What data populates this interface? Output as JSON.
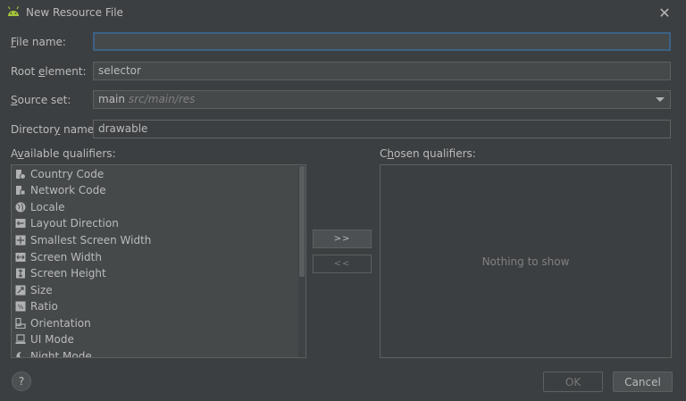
{
  "window": {
    "title": "New Resource File",
    "icon": "android-icon",
    "close_icon": "close-icon"
  },
  "form": {
    "file_name": {
      "label_key": "F",
      "label_rest": "ile name:",
      "value": ""
    },
    "root_element": {
      "label_pre": "Root ",
      "label_key": "e",
      "label_rest": "lement:",
      "value": "selector"
    },
    "source_set": {
      "label_key": "S",
      "label_rest": "ource set:",
      "value": "main",
      "hint": "src/main/res"
    },
    "directory_name": {
      "label_pre": "Director",
      "label_key": "y",
      "label_rest": " name:",
      "value": "drawable"
    }
  },
  "available": {
    "label_pre": "A",
    "label_key": "v",
    "label_rest": "ailable qualifiers:",
    "items": [
      {
        "label": "Country Code",
        "icon": "country-code-icon",
        "selected": true
      },
      {
        "label": "Network Code",
        "icon": "network-code-icon",
        "selected": false
      },
      {
        "label": "Locale",
        "icon": "globe-icon",
        "selected": false
      },
      {
        "label": "Layout Direction",
        "icon": "layout-direction-icon",
        "selected": false
      },
      {
        "label": "Smallest Screen Width",
        "icon": "smallest-width-icon",
        "selected": false
      },
      {
        "label": "Screen Width",
        "icon": "screen-width-icon",
        "selected": false
      },
      {
        "label": "Screen Height",
        "icon": "screen-height-icon",
        "selected": false
      },
      {
        "label": "Size",
        "icon": "size-icon",
        "selected": false
      },
      {
        "label": "Ratio",
        "icon": "ratio-icon",
        "selected": false
      },
      {
        "label": "Orientation",
        "icon": "orientation-icon",
        "selected": false
      },
      {
        "label": "UI Mode",
        "icon": "ui-mode-icon",
        "selected": false
      },
      {
        "label": "Night Mode",
        "icon": "night-mode-icon",
        "selected": false
      }
    ]
  },
  "chosen": {
    "label_pre": "C",
    "label_key": "h",
    "label_rest": "osen qualifiers:",
    "empty_text": "Nothing to show"
  },
  "buttons": {
    "add": ">>",
    "remove": "<<",
    "help": "?",
    "ok": "OK",
    "cancel": "Cancel"
  },
  "colors": {
    "background": "#3c3f41",
    "field": "#45494a",
    "selection": "#4b6eaf",
    "focus_border": "#3d6185",
    "android_green": "#a4c639"
  }
}
